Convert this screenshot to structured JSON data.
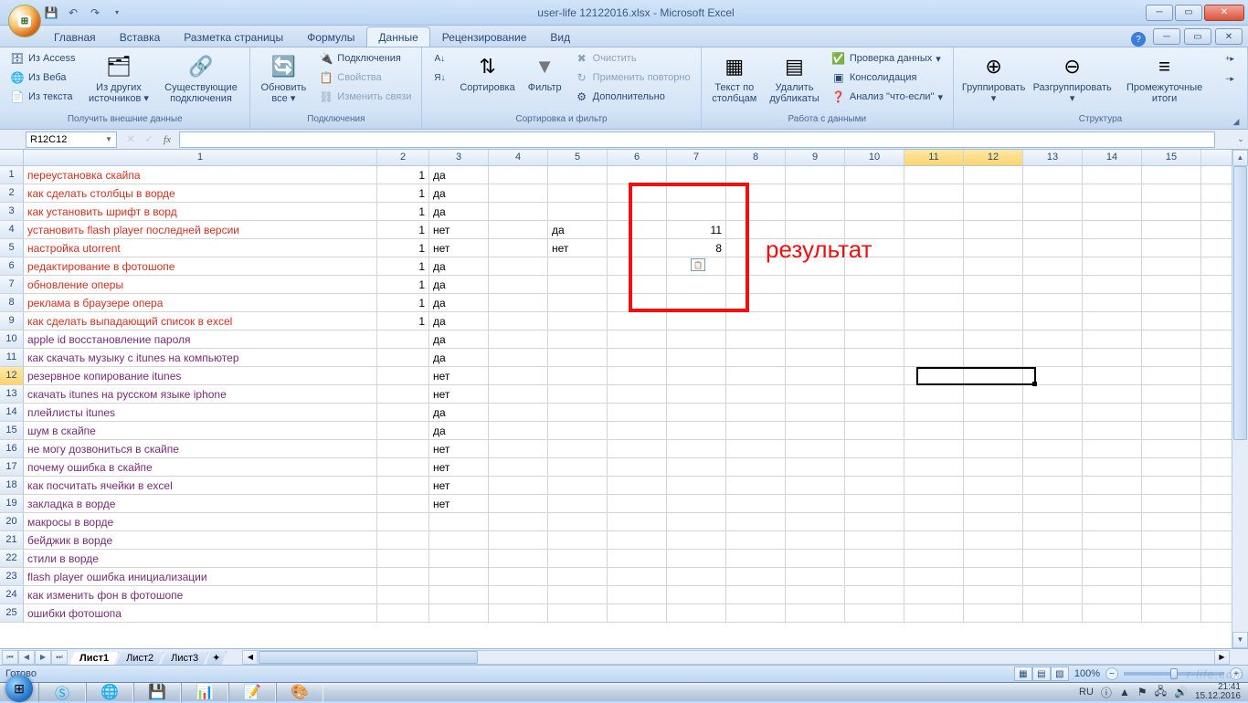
{
  "title": "user-life 12122016.xlsx - Microsoft Excel",
  "tabs": [
    "Главная",
    "Вставка",
    "Разметка страницы",
    "Формулы",
    "Данные",
    "Рецензирование",
    "Вид"
  ],
  "active_tab": 4,
  "ribbon": {
    "g1": {
      "label": "Получить внешние данные",
      "access": "Из Access",
      "web": "Из Веба",
      "text": "Из текста",
      "other": "Из других источников",
      "existing": "Существующие подключения"
    },
    "g2": {
      "label": "Подключения",
      "refresh": "Обновить все",
      "conn": "Подключения",
      "props": "Свойства",
      "editlinks": "Изменить связи"
    },
    "g3": {
      "label": "Сортировка и фильтр",
      "az": "↓",
      "za": "↓",
      "sort": "Сортировка",
      "filter": "Фильтр",
      "clear": "Очистить",
      "reapply": "Применить повторно",
      "adv": "Дополнительно"
    },
    "g4": {
      "label": "Работа с данными",
      "t2c": "Текст по столбцам",
      "dedup": "Удалить дубликаты",
      "valid": "Проверка данных",
      "consol": "Консолидация",
      "whatif": "Анализ \"что-если\""
    },
    "g5": {
      "label": "Структура",
      "group": "Группировать",
      "ungroup": "Разгруппировать",
      "subtotal": "Промежуточные итоги"
    }
  },
  "namebox": "R12C12",
  "columns": [
    1,
    2,
    3,
    4,
    5,
    6,
    7,
    8,
    9,
    10,
    11,
    12,
    13,
    14,
    15
  ],
  "sel_cols": [
    11,
    12
  ],
  "rows": [
    {
      "n": 1,
      "t": "переустановка скайпа",
      "cls": "red",
      "c2": "1",
      "c3": "да"
    },
    {
      "n": 2,
      "t": "как сделать столбцы в ворде",
      "cls": "red",
      "c2": "1",
      "c3": "да"
    },
    {
      "n": 3,
      "t": "как установить шрифт в ворд",
      "cls": "red",
      "c2": "1",
      "c3": "да"
    },
    {
      "n": 4,
      "t": "установить flash player последней версии",
      "cls": "red",
      "c2": "1",
      "c3": "нет",
      "c5": "да",
      "c7": "11"
    },
    {
      "n": 5,
      "t": "настройка utorrent",
      "cls": "red",
      "c2": "1",
      "c3": "нет",
      "c5": "нет",
      "c7": "8"
    },
    {
      "n": 6,
      "t": "редактирование в фотошопе",
      "cls": "red",
      "c2": "1",
      "c3": "да"
    },
    {
      "n": 7,
      "t": "обновление оперы",
      "cls": "red",
      "c2": "1",
      "c3": "да"
    },
    {
      "n": 8,
      "t": "реклама в браузере опера",
      "cls": "red",
      "c2": "1",
      "c3": "да"
    },
    {
      "n": 9,
      "t": "как сделать выпадающий список в excel",
      "cls": "red",
      "c2": "1",
      "c3": "да"
    },
    {
      "n": 10,
      "t": "apple id восстановление пароля",
      "cls": "purple",
      "c3": "да"
    },
    {
      "n": 11,
      "t": "как скачать музыку с itunes на компьютер",
      "cls": "purple",
      "c3": "да"
    },
    {
      "n": 12,
      "t": "резервное копирование itunes",
      "cls": "purple",
      "c3": "нет"
    },
    {
      "n": 13,
      "t": "скачать itunes на русском языке iphone",
      "cls": "purple",
      "c3": "нет"
    },
    {
      "n": 14,
      "t": "плейлисты itunes",
      "cls": "purple",
      "c3": "да"
    },
    {
      "n": 15,
      "t": "шум в скайпе",
      "cls": "purple",
      "c3": "да"
    },
    {
      "n": 16,
      "t": "не могу дозвониться в скайпе",
      "cls": "purple",
      "c3": "нет"
    },
    {
      "n": 17,
      "t": "почему ошибка в скайпе",
      "cls": "purple",
      "c3": "нет"
    },
    {
      "n": 18,
      "t": "как посчитать ячейки в excel",
      "cls": "purple",
      "c3": "нет"
    },
    {
      "n": 19,
      "t": "закладка в ворде",
      "cls": "purple",
      "c3": "нет"
    },
    {
      "n": 20,
      "t": "макросы в ворде",
      "cls": "purple"
    },
    {
      "n": 21,
      "t": "бейджик в ворде",
      "cls": "purple"
    },
    {
      "n": 22,
      "t": "стили в ворде",
      "cls": "purple"
    },
    {
      "n": 23,
      "t": "flash player ошибка инициализации",
      "cls": "purple"
    },
    {
      "n": 24,
      "t": "как изменить фон в фотошопе",
      "cls": "purple"
    },
    {
      "n": 25,
      "t": "ошибки фотошопа",
      "cls": "purple"
    }
  ],
  "annotation": "результат",
  "sheets": [
    "Лист1",
    "Лист2",
    "Лист3"
  ],
  "active_sheet": 0,
  "status": "Готово",
  "zoom": "100%",
  "lang": "RU",
  "time": "21:41",
  "date": "15.12.2016",
  "watermark": "r-life.com"
}
